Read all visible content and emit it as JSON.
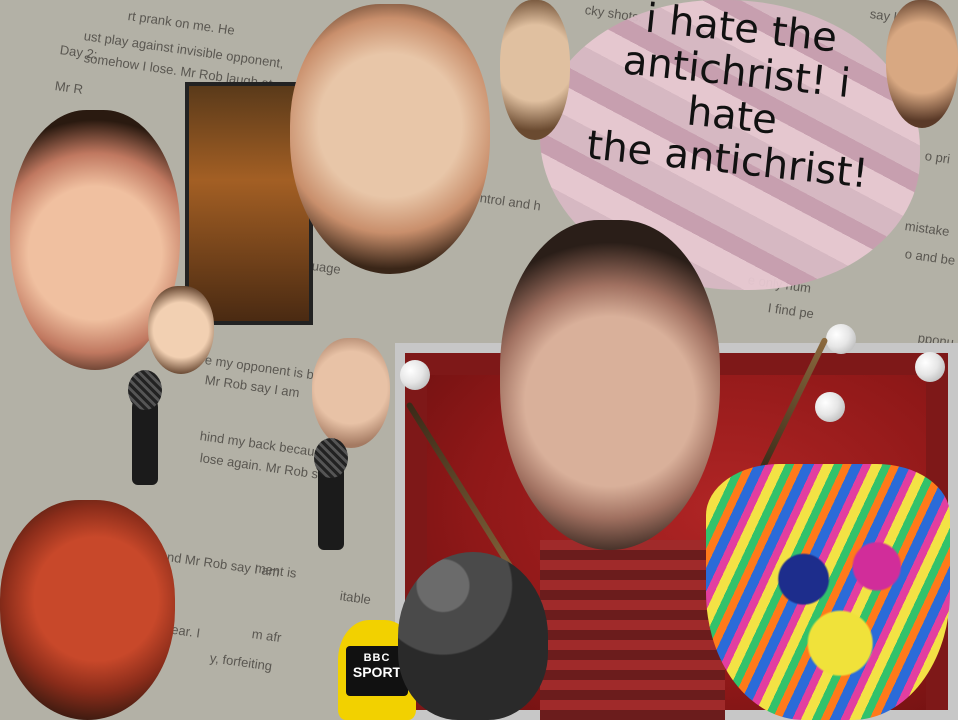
{
  "caption": {
    "line1": "i hate the",
    "line2": "antichrist! i hate",
    "line3": "the antichrist!"
  },
  "background_text": [
    "rt prank on me. He",
    "ust play against invisible opponent,",
    "somehow I lose. Mr Rob laugh at me a",
    "Day 2:",
    "Mr R",
    "ntrol and h",
    "uage",
    "e my opponent is blin",
    "Mr Rob say I am",
    "hind my back because m",
    "lose again. Mr Rob sa",
    "ment is",
    "and Mr Rob say I am",
    "r fear. I",
    "y, forfeiting",
    "cky shots.",
    "say k",
    "o pri",
    "mistake",
    "e only hum",
    "I find pe",
    "o and be",
    "pponu",
    "itable",
    "m afr"
  ],
  "mic_label": {
    "top": "BBC",
    "bottom": "SPORT"
  },
  "colors": {
    "background": "#b3b1a6",
    "pool_felt": "#8f1818",
    "bbc_yellow": "#f2d100",
    "caption_text": "#111111"
  }
}
